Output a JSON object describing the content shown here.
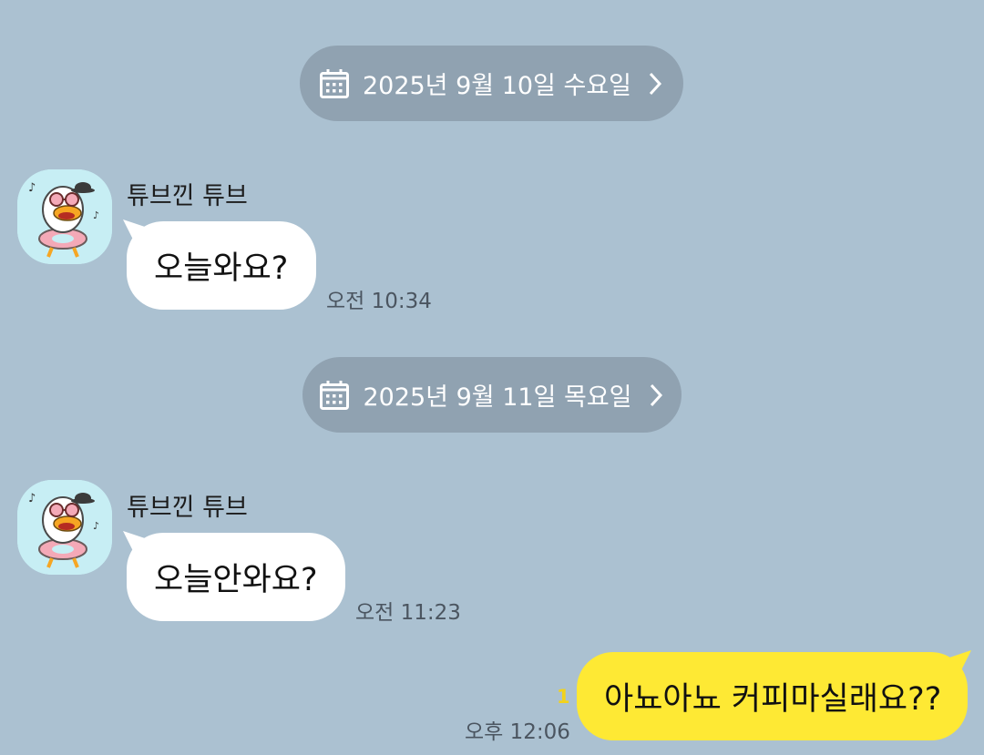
{
  "dates": [
    {
      "label": "2025년 9월 10일 수요일"
    },
    {
      "label": "2025년 9월 11일 목요일"
    }
  ],
  "icons": {
    "calendar": "calendar-icon",
    "chevron": "chevron-right-icon",
    "avatar": "duck-character-avatar"
  },
  "colors": {
    "background": "#abc1d1",
    "date_pill": "#90a2b1",
    "incoming_bubble": "#ffffff",
    "outgoing_bubble": "#fee934",
    "unread_count": "#f2d21c"
  },
  "messages": [
    {
      "sender": "튜브낀 튜브",
      "text": "오늘와요?",
      "time": "오전 10:34"
    },
    {
      "sender": "튜브낀 튜브",
      "text": "오늘안와요?",
      "time": "오전 11:23"
    },
    {
      "text": "아뇨아뇨 커피마실래요??",
      "time": "오후 12:06",
      "unread": "1"
    }
  ]
}
